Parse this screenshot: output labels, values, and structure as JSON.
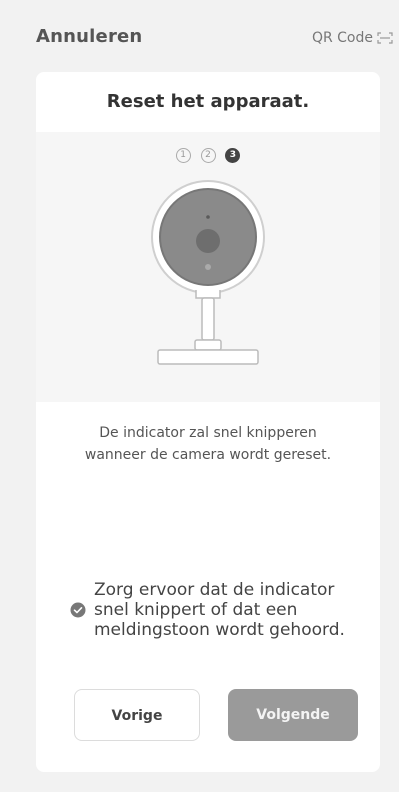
{
  "header": {
    "cancel_label": "Annuleren",
    "qr_label": "QR Code"
  },
  "card": {
    "title": "Reset het apparaat.",
    "steps": [
      "1",
      "2",
      "3"
    ],
    "active_step": 3,
    "description_line1": "De indicator zal snel knipperen",
    "description_line2": "wanneer de camera wordt gereset.",
    "confirm_text_line1": "Zorg ervoor dat de indicator",
    "confirm_text_line2": "snel knippert of dat een",
    "confirm_text_line3": "meldingstoon wordt gehoord.",
    "confirm_checked": true
  },
  "buttons": {
    "prev_label": "Vorige",
    "next_label": "Volgende"
  },
  "icons": {
    "qr": "qr-scan-icon",
    "check": "check-circle-icon",
    "camera": "camera-illustration"
  },
  "colors": {
    "background": "#f2f2f2",
    "card": "#ffffff",
    "next_button": "#9a9a9a",
    "active_step": "#444444"
  }
}
